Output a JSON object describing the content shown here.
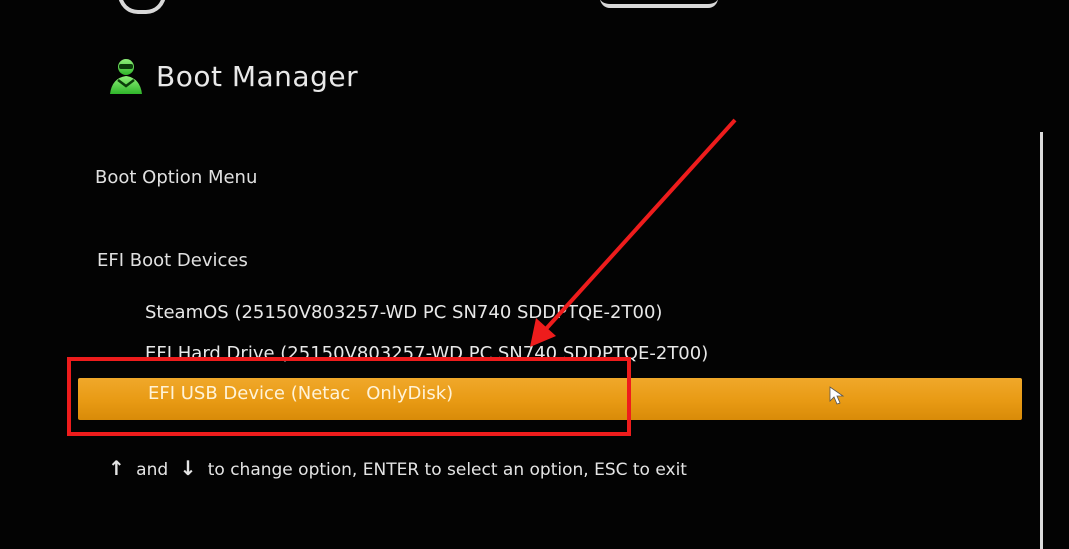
{
  "header": {
    "title": "Boot Manager",
    "icon": "boot-manager-icon",
    "icon_color": "#4cd64a"
  },
  "menu": {
    "title": "Boot Option Menu"
  },
  "section": {
    "title": "EFI Boot Devices"
  },
  "options": [
    {
      "label": "SteamOS (25150V803257-WD PC SN740 SDDPTQE-2T00)"
    },
    {
      "label": "EFI Hard Drive (25150V803257-WD PC SN740 SDDPTQE-2T00)"
    },
    {
      "label_part1": "EFI USB Device (Netac",
      "label_part2": "OnlyDisk)",
      "selected": true
    }
  ],
  "help": {
    "up_arrow": "↑",
    "and": "and",
    "down_arrow": "↓",
    "text": "to change option, ENTER to select an option, ESC to exit"
  },
  "colors": {
    "background": "#030303",
    "highlight": "#e89a14",
    "annotation": "#ee1c1c"
  }
}
